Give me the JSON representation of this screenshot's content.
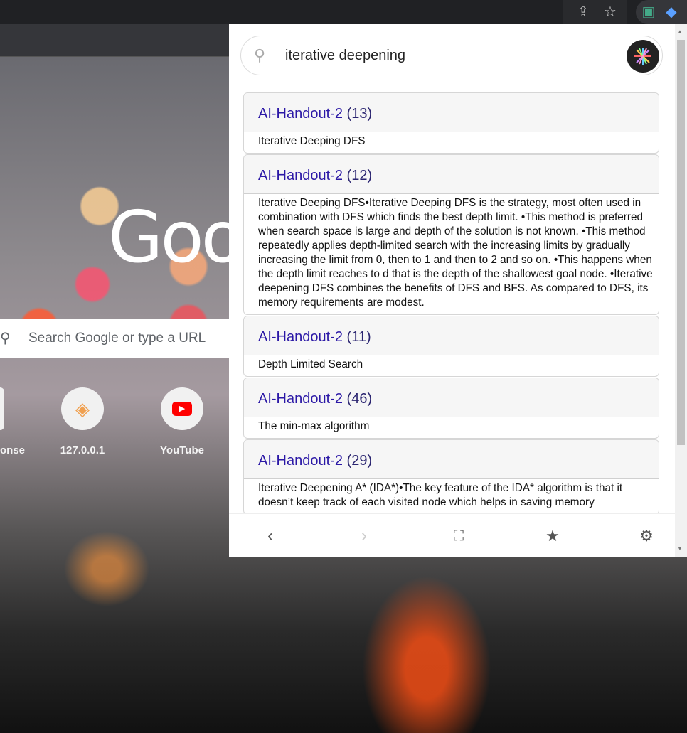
{
  "browser": {
    "icons": [
      "share-icon",
      "bookmark-star-icon",
      "extension-icon",
      "extension-active-icon"
    ]
  },
  "newtab": {
    "logo": "Goo",
    "search_placeholder": "Search Google or type a URL",
    "shortcuts": [
      {
        "label": "onse"
      },
      {
        "label": "127.0.0.1"
      },
      {
        "label": "YouTube"
      }
    ]
  },
  "popup": {
    "search": {
      "value": "iterative deepening"
    },
    "results": [
      {
        "title": "AI-Handout-2",
        "page": "(13)",
        "snippet": "Iterative Deeping DFS"
      },
      {
        "title": "AI-Handout-2",
        "page": "(12)",
        "snippet": "Iterative Deeping DFS•Iterative Deeping DFS is the strategy, most often used in combination with DFS which finds the best depth limit. •This method is preferred when search space is large and depth of the solution is not known. •This method repeatedly applies depth-limited search with the increasing limits by gradually increasing the limit from 0, then to 1 and then to 2 and so on. •This happens when the depth limit reaches to d that is the depth of the shallowest goal node. •Iterative deepening DFS combines the benefits of DFS and BFS. As compared to DFS, its memory requirements are modest."
      },
      {
        "title": "AI-Handout-2",
        "page": "(11)",
        "snippet": "Depth Limited Search"
      },
      {
        "title": "AI-Handout-2",
        "page": "(46)",
        "snippet": "The min-max algorithm"
      },
      {
        "title": "AI-Handout-2",
        "page": "(29)",
        "snippet": "Iterative Deepening A* (IDA*)•The key feature of the IDA* algorithm is that it doesn’t keep track of each visited node which helps in saving memory"
      }
    ],
    "footer": {
      "icons": [
        "back-icon",
        "forward-icon",
        "fullscreen-icon",
        "star-icon",
        "settings-icon"
      ]
    }
  }
}
